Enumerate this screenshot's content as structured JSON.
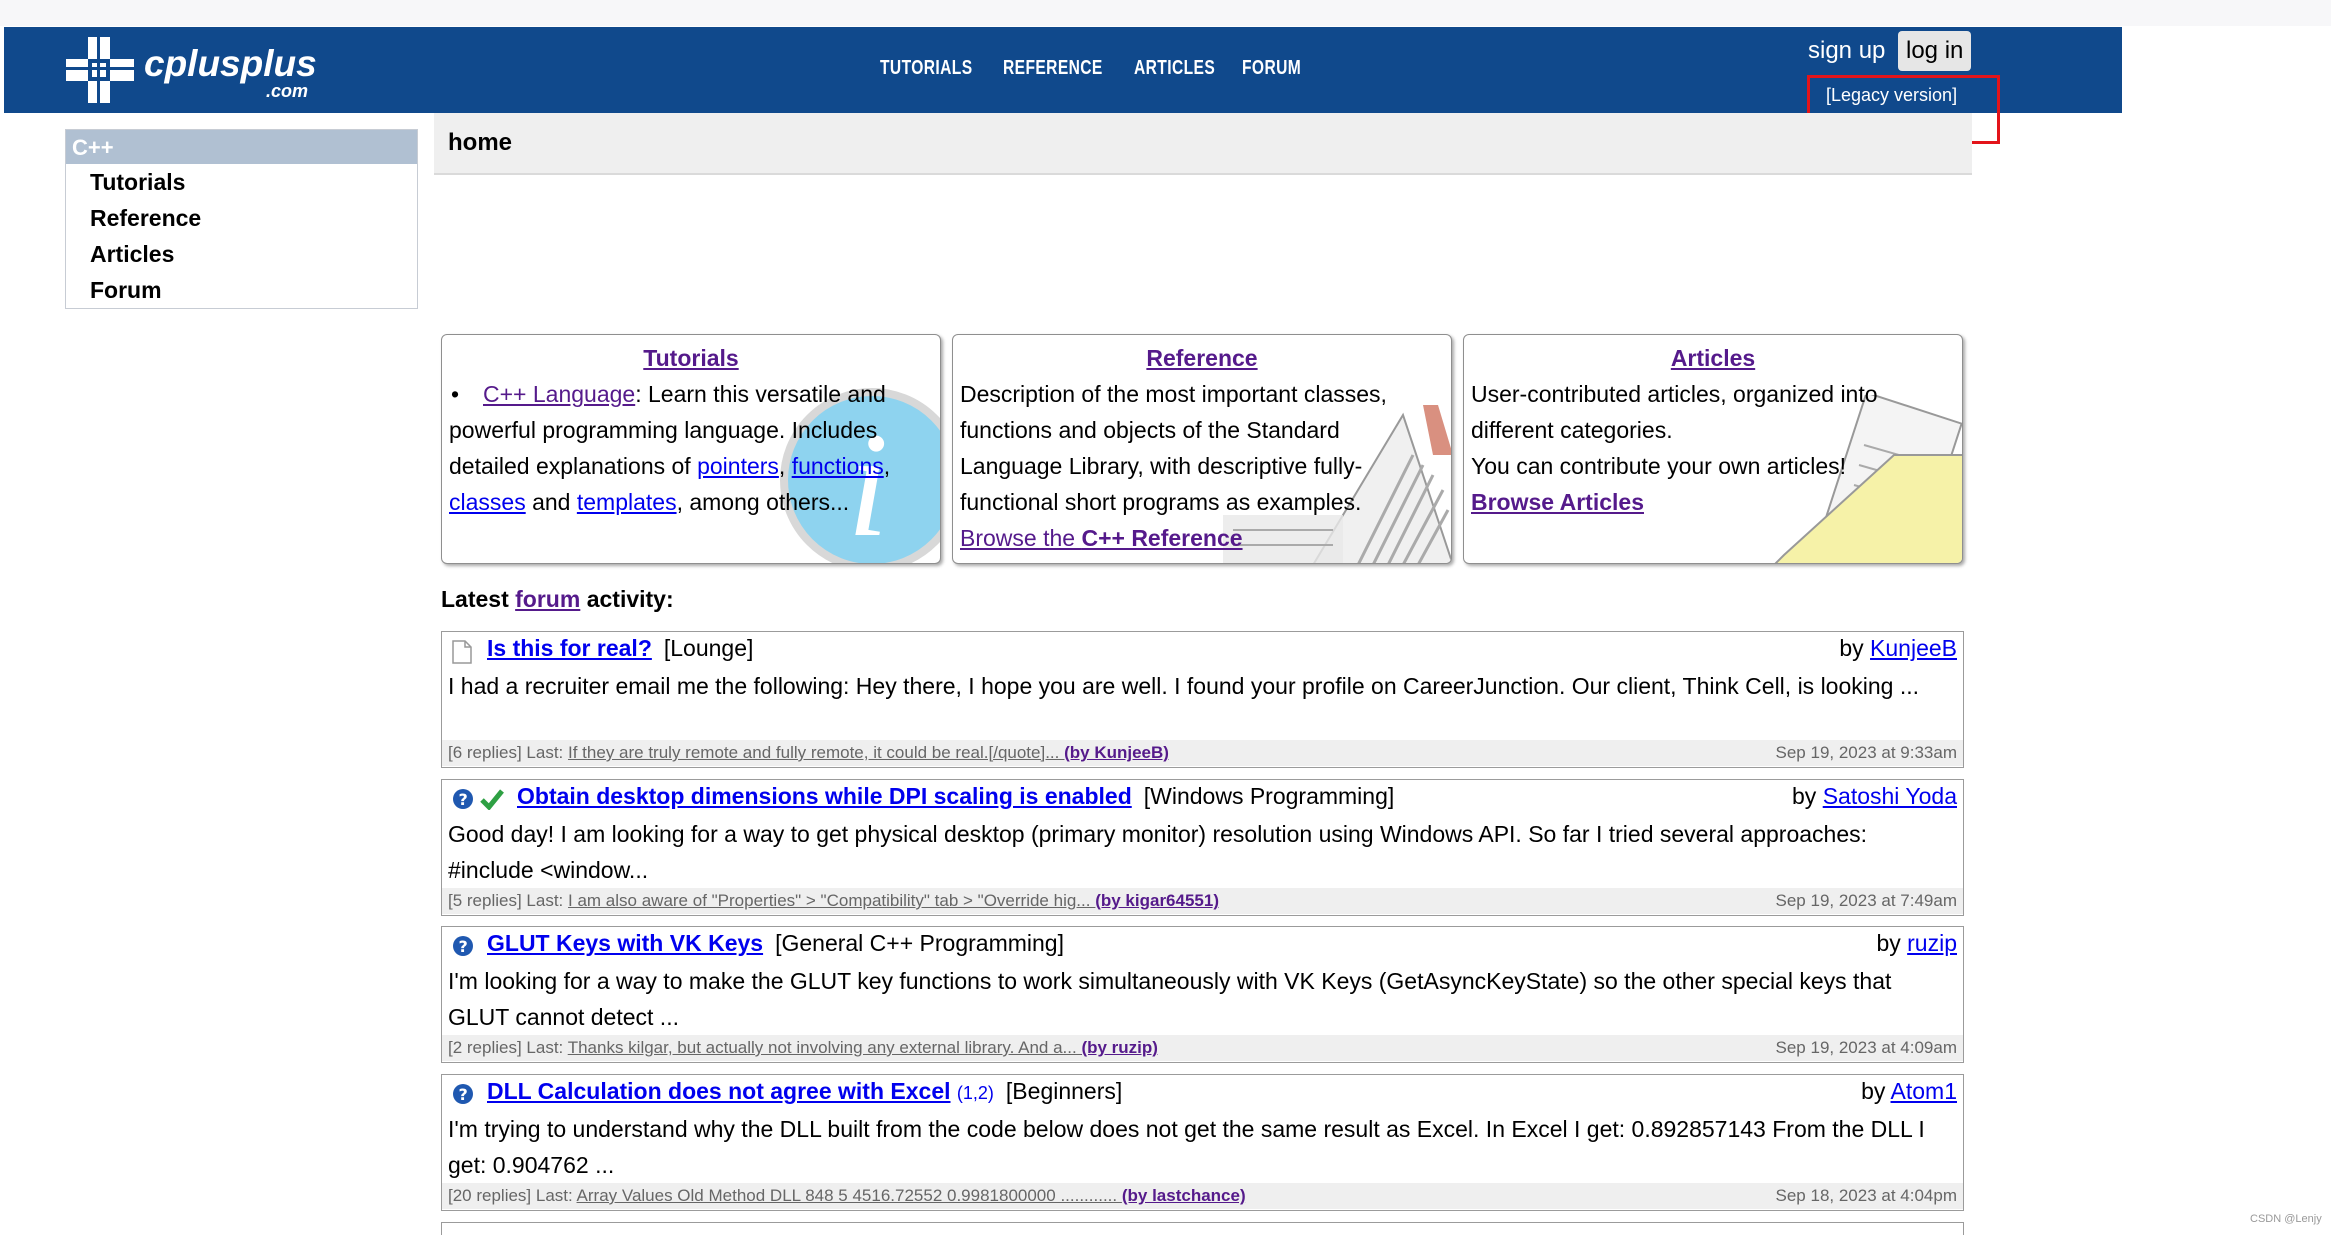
{
  "header": {
    "logo_text": "cplusplus",
    "logo_suffix": ".com",
    "nav": [
      "TUTORIALS",
      "REFERENCE",
      "ARTICLES",
      "FORUM"
    ],
    "sign_up": "sign up",
    "log_in": "log in",
    "legacy": "[Legacy version]"
  },
  "sidebar": {
    "heading": "C++",
    "items": [
      "Tutorials",
      "Reference",
      "Articles",
      "Forum"
    ]
  },
  "page": {
    "title": "home"
  },
  "cards": {
    "tutorials": {
      "title": "Tutorials",
      "link": "C++ Language",
      "t1": ": Learn this versatile and powerful programming language. Includes detailed explanations of ",
      "pointers": "pointers",
      "functions": "functions",
      "classes": "classes",
      "and": " and ",
      "templates": "templates",
      "tail": ", among others..."
    },
    "reference": {
      "title": "Reference",
      "text": "Description of the most important classes, functions and objects of the Standard Language Library, with descriptive fully-functional short programs as examples.",
      "browse_prefix": "Browse the ",
      "browse_bold": "C++ Reference"
    },
    "articles": {
      "title": "Articles",
      "text1": "User-contributed articles, organized into different categories.",
      "text2": "You can contribute your own articles!",
      "browse": "Browse Articles"
    }
  },
  "latest": {
    "prefix": "Latest ",
    "link": "forum",
    "suffix": " activity:"
  },
  "posts": [
    {
      "title": "Is this for real?",
      "category": "[Lounge]",
      "by_label": "by ",
      "author": "KunjeeB",
      "text": "I had a recruiter email me the following: Hey there, I hope you are well. I found your profile on CareerJunction. Our client, Think Cell, is looking ...",
      "replies": "[6 replies] Last: ",
      "last": "If they are truly remote and fully remote, it could be real.[/quote]... ",
      "last_by": "(by KunjeeB)",
      "date": "Sep 19, 2023 at 9:33am"
    },
    {
      "title": "Obtain desktop dimensions while DPI scaling is enabled",
      "category": "[Windows Programming]",
      "by_label": "by ",
      "author": "Satoshi Yoda",
      "text": "Good day! I am looking for a way to get physical desktop (primary monitor) resolution using Windows API. So far I tried several approaches: #include <window...",
      "replies": "[5 replies] Last: ",
      "last": "I am also aware of \"Properties\" > \"Compatibility\" tab > \"Override hig... ",
      "last_by": "(by kigar64551)",
      "date": "Sep 19, 2023 at 7:49am"
    },
    {
      "title": "GLUT Keys with VK Keys",
      "category": "[General C++ Programming]",
      "by_label": "by ",
      "author": "ruzip",
      "text": "I'm looking for a way to make the GLUT key functions to work simultaneously with VK Keys (GetAsyncKeyState) so the other special keys that GLUT cannot detect ...",
      "replies": "[2 replies] Last: ",
      "last": "Thanks kilgar, but actually not involving any external library. And a... ",
      "last_by": "(by ruzip)",
      "date": "Sep 19, 2023 at 4:09am"
    },
    {
      "title": "DLL Calculation does not agree with Excel",
      "pages": "(1,2)",
      "category": "[Beginners]",
      "by_label": "by ",
      "author": "Atom1",
      "text": "I'm trying to understand why the DLL built from the code below does not get the same result as Excel. In Excel I get: 0.892857143 From the DLL I get: 0.904762 ...",
      "replies": "[20 replies] Last: ",
      "last": "Array Values Old Method DLL 848 5 4516.72552 0.9981800000 ............ ",
      "last_by": "(by lastchance)",
      "date": "Sep 18, 2023 at 4:04pm"
    }
  ],
  "watermark": "CSDN @Lenjy",
  "colors": {
    "header_bg": "#10498c",
    "sidebar_head": "#b0c0d2",
    "highlight_box": "#e3141a"
  }
}
